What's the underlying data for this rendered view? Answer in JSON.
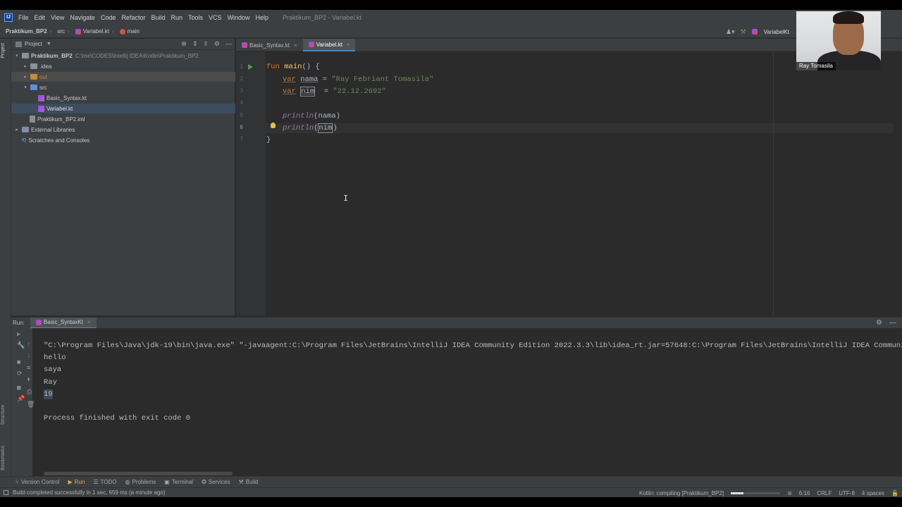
{
  "window_title": "Praktikum_BP2 - Variabel.kt",
  "menu": [
    "File",
    "Edit",
    "View",
    "Navigate",
    "Code",
    "Refactor",
    "Build",
    "Run",
    "Tools",
    "VCS",
    "Window",
    "Help"
  ],
  "breadcrumb": [
    "Praktikum_BP2",
    "src",
    "Variabel.kt",
    "main"
  ],
  "run_config": "VariabelKt",
  "left_stripe": {
    "project": "Project",
    "structure": "Structure",
    "bookmarks": "Bookmarks"
  },
  "project_panel": {
    "title": "Project",
    "tree": [
      {
        "label": "Praktikum_BP2",
        "path": "C:\\me\\CODES\\Intellij IDEA\\Kotlin\\Praktikum_BP2"
      },
      {
        "label": ".idea"
      },
      {
        "label": "out"
      },
      {
        "label": "src"
      },
      {
        "label": "Basic_Syntax.kt"
      },
      {
        "label": "Variabel.kt"
      },
      {
        "label": "Praktikum_BP2.iml"
      },
      {
        "label": "External Libraries"
      },
      {
        "label": "Scratches and Consoles"
      }
    ]
  },
  "editor_tabs": [
    "Basic_Syntax.kt",
    "Variabel.kt"
  ],
  "editor": {
    "line_numbers": [
      "1",
      "2",
      "3",
      "4",
      "5",
      "6",
      "7"
    ],
    "code": {
      "l1_kw": "fun",
      "l1_fn": "main",
      "l1_rest": "() {",
      "l2_kw": "var",
      "l2_name": "nama",
      "l2_eq": " = ",
      "l2_str": "\"Ray Febriant Tomasila\"",
      "l3_kw": "var",
      "l3_name": "nim",
      "l3_eq": "  = ",
      "l3_str": "\"22.12.2692\"",
      "l5_call": "println",
      "l5_arg": "(nama)",
      "l6_call": "println",
      "l6_open": "(",
      "l6_arg": "nim",
      "l6_close": ")",
      "l7": "}"
    }
  },
  "run_panel": {
    "label": "Run:",
    "tab": "Basic_SyntaxKt",
    "output": [
      "\"C:\\Program Files\\Java\\jdk-19\\bin\\java.exe\" \"-javaagent:C:\\Program Files\\JetBrains\\IntelliJ IDEA Community Edition 2022.3.3\\lib\\idea_rt.jar=57648:C:\\Program Files\\JetBrains\\IntelliJ IDEA Community Edi",
      "hello",
      "saya",
      "Ray",
      "19",
      "",
      "Process finished with exit code 0"
    ]
  },
  "tool_windows": [
    "Version Control",
    "Run",
    "TODO",
    "Problems",
    "Terminal",
    "Services",
    "Build"
  ],
  "status": {
    "message": "Build completed successfully in 1 sec, 659 ms (a minute ago)",
    "task": "Kotlin: compiling [Praktikum_BP2]",
    "progress": 0.25,
    "position": "6:16",
    "line_sep": "CRLF",
    "encoding": "UTF-8",
    "indent": "4 spaces"
  },
  "webcam": {
    "name": "Ray Tomasila"
  },
  "colors": {
    "keyword": "#cc7832",
    "string": "#6a8759",
    "function": "#ffc66d",
    "call": "#9876aa",
    "accent": "#4a88c7"
  }
}
